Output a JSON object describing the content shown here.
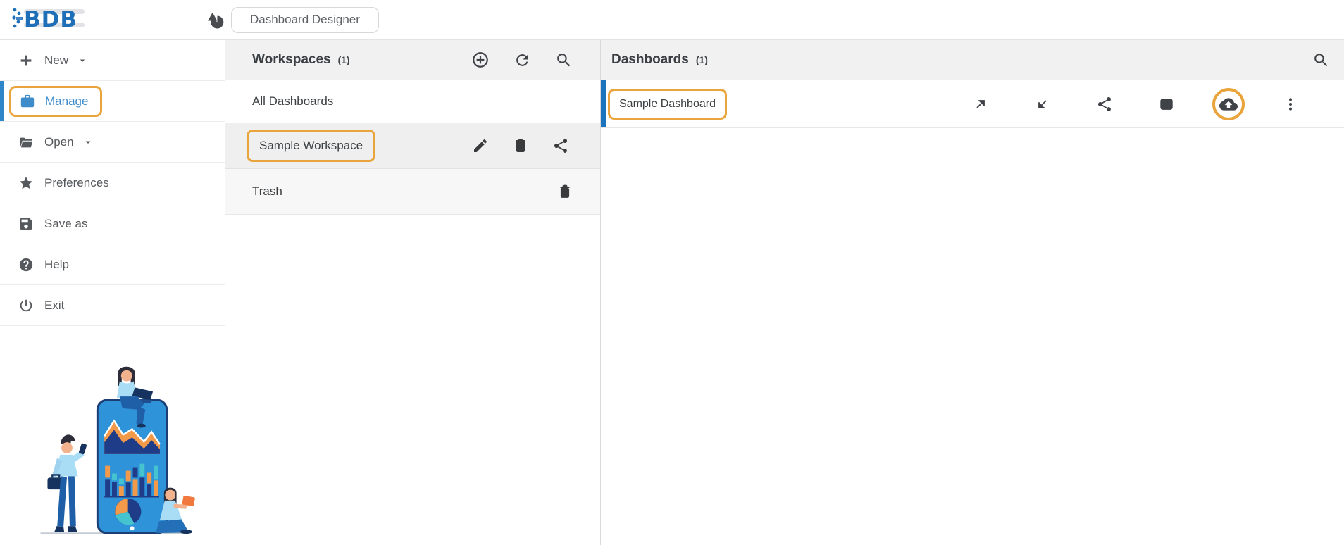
{
  "colors": {
    "accent_blue": "#3f8ccb",
    "selection_blue": "#1b74bc",
    "sidebar_active_bar_blue": "#2e86c8",
    "highlight_orange": "#e9a53c",
    "logo_blue": "#1e6fb8",
    "icon_gray": "#4a4b4e",
    "text_dark": "#3c4043",
    "header_bg": "#f1f1f2"
  },
  "topbar": {
    "logo_text": "BDB",
    "app_icon": "pie-chart-triangle-icon",
    "app_title": "Dashboard Designer"
  },
  "sidebar": {
    "items": [
      {
        "label": "New",
        "icon": "plus-icon",
        "caret": true,
        "active": false
      },
      {
        "label": "Manage",
        "icon": "briefcase-icon",
        "caret": false,
        "active": true
      },
      {
        "label": "Open",
        "icon": "folder-open-icon",
        "caret": true,
        "active": false
      },
      {
        "label": "Preferences",
        "icon": "star-icon",
        "caret": false,
        "active": false
      },
      {
        "label": "Save as",
        "icon": "save-icon",
        "caret": false,
        "active": false
      },
      {
        "label": "Help",
        "icon": "help-icon",
        "caret": false,
        "active": false
      },
      {
        "label": "Exit",
        "icon": "power-icon",
        "caret": false,
        "active": false
      }
    ],
    "illustration": "people-with-giant-phone-analytics"
  },
  "workspaces_panel": {
    "title": "Workspaces",
    "count_label": "(1)",
    "toolbar_icons": [
      "add-circle-icon",
      "refresh-icon",
      "search-icon"
    ],
    "rows": [
      {
        "label": "All Dashboards",
        "highlighted": false,
        "actions": []
      },
      {
        "label": "Sample Workspace",
        "highlighted": true,
        "actions": [
          "edit-icon",
          "delete-icon",
          "share-icon"
        ]
      },
      {
        "label": "Trash",
        "highlighted": false,
        "actions": [
          "empty-trash-icon"
        ]
      }
    ]
  },
  "dashboards_panel": {
    "title": "Dashboards",
    "count_label": "(1)",
    "toolbar_icons": [
      "search-icon"
    ],
    "rows": [
      {
        "label": "Sample Dashboard",
        "highlighted": true,
        "selected": true,
        "actions": [
          "arrow-up-right-icon",
          "arrow-down-left-icon",
          "share-icon",
          "open-in-window-icon",
          "cloud-upload-icon",
          "more-vert-icon"
        ],
        "annotated_action": "cloud-upload-icon"
      }
    ]
  }
}
